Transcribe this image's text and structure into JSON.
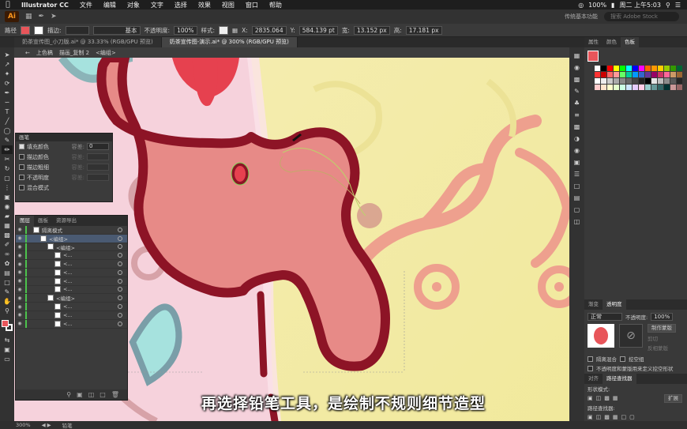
{
  "menubar": {
    "app": "Illustrator CC",
    "items": [
      "文件",
      "编辑",
      "对象",
      "文字",
      "选择",
      "效果",
      "视图",
      "窗口",
      "帮助"
    ],
    "battery": "100%",
    "clock": "周二 上午5:03"
  },
  "appbar": {
    "logo": "Ai",
    "workspace": "传统基本功能",
    "search_placeholder": "搜索 Adobe Stock"
  },
  "control": {
    "object": "路径",
    "stroke_label": "描边:",
    "stroke_style": "基本",
    "opacity_label": "不透明度:",
    "opacity": "100%",
    "style_label": "样式:",
    "x_label": "X:",
    "x": "2835.064",
    "y_label": "Y:",
    "y": "584.139 pt",
    "w_label": "宽:",
    "w": "13.152 px",
    "h_label": "高:",
    "h": "17.181 px",
    "fill_color": "#e8555a"
  },
  "tabs": [
    {
      "label": "奶茶宣传图_小刀版.ai* @ 33.33% (RGB/GPU 预览)",
      "active": false
    },
    {
      "label": "奶茶宣传图-演示.ai* @ 300% (RGB/GPU 预览)",
      "active": true
    }
  ],
  "breadcrumb": [
    "上色稿",
    "描画_复制 2",
    "<编组>"
  ],
  "brush_panel": {
    "title": "画笔",
    "rows": [
      {
        "label": "填充颜色",
        "checked": true,
        "key": "容差:",
        "value": "0"
      },
      {
        "label": "描边颜色",
        "checked": false,
        "key": "容差:",
        "value": ""
      },
      {
        "label": "描边粗细",
        "checked": false,
        "key": "容差:",
        "value": ""
      },
      {
        "label": "不透明度",
        "checked": false,
        "key": "容差:",
        "value": ""
      },
      {
        "label": "混合模式",
        "checked": false,
        "key": "",
        "value": ""
      }
    ]
  },
  "layers_panel": {
    "tabs": [
      "图层",
      "画板",
      "资源导出"
    ],
    "rows": [
      {
        "name": "隔离模式",
        "indent": 0,
        "selected": false
      },
      {
        "name": "<编组>",
        "indent": 1,
        "selected": true
      },
      {
        "name": "<编组>",
        "indent": 2,
        "selected": false
      },
      {
        "name": "<...",
        "indent": 3,
        "selected": false
      },
      {
        "name": "<...",
        "indent": 3,
        "selected": false
      },
      {
        "name": "<...",
        "indent": 3,
        "selected": false
      },
      {
        "name": "<...",
        "indent": 3,
        "selected": false
      },
      {
        "name": "<...",
        "indent": 3,
        "selected": false
      },
      {
        "name": "<编组>",
        "indent": 2,
        "selected": false
      },
      {
        "name": "<...",
        "indent": 3,
        "selected": false
      },
      {
        "name": "<...",
        "indent": 3,
        "selected": false
      },
      {
        "name": "<...",
        "indent": 3,
        "selected": false
      }
    ]
  },
  "swatches": {
    "tabs": [
      "属性",
      "颜色",
      "色板"
    ],
    "colors": [
      "#ffffff",
      "#000000",
      "#ff0000",
      "#ffff00",
      "#00ff00",
      "#00ffff",
      "#0000ff",
      "#ff00ff",
      "#ff6600",
      "#ff9900",
      "#ffcc00",
      "#99cc00",
      "#339900",
      "#006633",
      "#ff3333",
      "#cc0000",
      "#ff6666",
      "#ff9999",
      "#66ff66",
      "#00cc99",
      "#0099ff",
      "#3366cc",
      "#663399",
      "#990066",
      "#cc3366",
      "#ff6699",
      "#cc9966",
      "#996633",
      "#ffffff",
      "#eeeeee",
      "#cccccc",
      "#aaaaaa",
      "#888888",
      "#666666",
      "#444444",
      "#222222",
      "#000000",
      "#e6e6e6",
      "#bfbfbf",
      "#8c8c8c",
      "#595959",
      "#262626",
      "#ffcccc",
      "#ffe5cc",
      "#ffffcc",
      "#e5ffcc",
      "#ccffe5",
      "#cce5ff",
      "#e5ccff",
      "#ffcce5",
      "#99cccc",
      "#669999",
      "#336666",
      "#003333",
      "#cc9999",
      "#996666"
    ]
  },
  "transparency": {
    "tabs": [
      "渐变",
      "透明度"
    ],
    "mode": "正常",
    "opacity_label": "不透明度:",
    "opacity": "100%",
    "make_mask": "制作蒙版",
    "clip": "剪切",
    "invert": "反相蒙版",
    "isolate": "隔离混合",
    "knockout": "挖空组",
    "opacity_mask": "不透明度和蒙版用来定义挖空形状"
  },
  "pathfinder": {
    "tabs": [
      "对齐",
      "路径查找器"
    ],
    "shape_modes": "形状模式:",
    "expand": "扩展",
    "pathfinders": "路径查找器:"
  },
  "status": {
    "zoom": "300%",
    "tool": "铅笔"
  },
  "subtitle": "再选择铅笔工具，是绘制不规则细节造型"
}
